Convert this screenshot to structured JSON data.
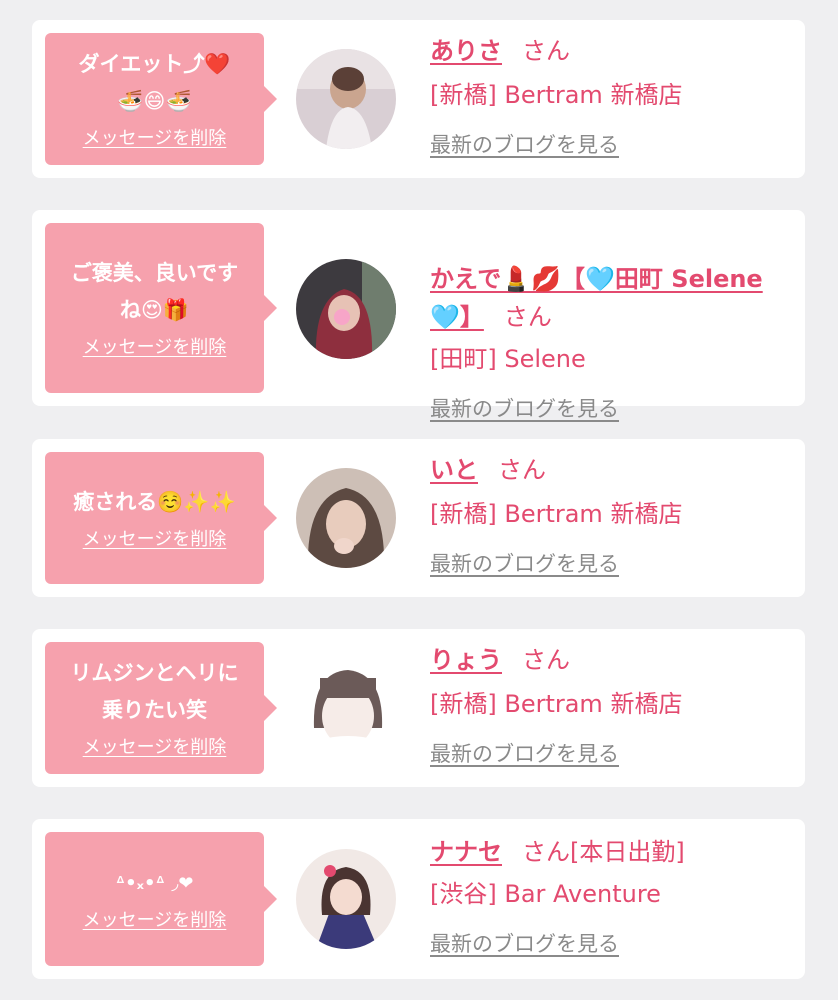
{
  "colors": {
    "accent": "#e34a6f",
    "bubble": "#f6a1ad",
    "page_bg": "#efeff1",
    "link_gray": "#8a8a8a"
  },
  "cards": [
    {
      "message": "ダイエット⤴︎❤️\n🍜😄🍜",
      "delete_label": "メッセージを削除",
      "name": "ありさ",
      "honorific": "さん",
      "shop": "[新橋] Bertram 新橋店",
      "blog_link": "最新のブログを見る"
    },
    {
      "message": "ご褒美、良いです\nね😍🎁",
      "delete_label": "メッセージを削除",
      "name": "かえで💄💋【🩵田町 Selene\n🩵】",
      "honorific": "さん",
      "shop": "[田町] Selene",
      "blog_link": "最新のブログを見る"
    },
    {
      "message": "癒される☺️✨✨",
      "delete_label": "メッセージを削除",
      "name": "いと",
      "honorific": "さん",
      "shop": "[新橋] Bertram 新橋店",
      "blog_link": "最新のブログを見る"
    },
    {
      "message": "リムジンとヘリに\n乗りたい笑",
      "delete_label": "メッセージを削除",
      "name": "りょう",
      "honorific": "さん",
      "shop": "[新橋] Bertram 新橋店",
      "blog_link": "最新のブログを見る"
    },
    {
      "message": "ᐞ•ₓ•ᐞ ◞❤︎",
      "delete_label": "メッセージを削除",
      "name": "ナナセ",
      "honorific": "さん[本日出勤]",
      "shop": "[渋谷] Bar Aventure",
      "blog_link": "最新のブログを見る"
    }
  ]
}
